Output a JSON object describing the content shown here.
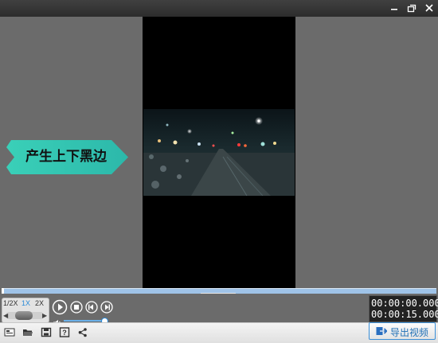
{
  "colors": {
    "background": "#6b6b6b",
    "titlebar": "#333333",
    "video_frame": "#000000",
    "banner_gradient_start": "#3fd6c0",
    "banner_gradient_end": "#2ab3a8",
    "accent": "#2a8ad8",
    "progress": "#9fc3e8"
  },
  "titlebar": {
    "icons": [
      "minimize-icon",
      "restore-icon",
      "close-icon"
    ]
  },
  "stage": {
    "banner_text": "产生上下黑边"
  },
  "playback": {
    "speeds": [
      "1/2X",
      "1X",
      "2X"
    ],
    "active_speed": "1X",
    "speed_slider_level": 0.5,
    "progress": 0.0,
    "volume_level": 1.0,
    "buttons": [
      "play-icon",
      "stop-icon",
      "previous-frame-icon",
      "next-frame-icon"
    ],
    "current_time": "00:00:00.000",
    "total_time": "00:00:15.000"
  },
  "bottombar": {
    "tools": [
      "new-icon",
      "open-folder-icon",
      "save-icon",
      "help-icon",
      "share-icon"
    ],
    "export_label": "导出视频"
  }
}
